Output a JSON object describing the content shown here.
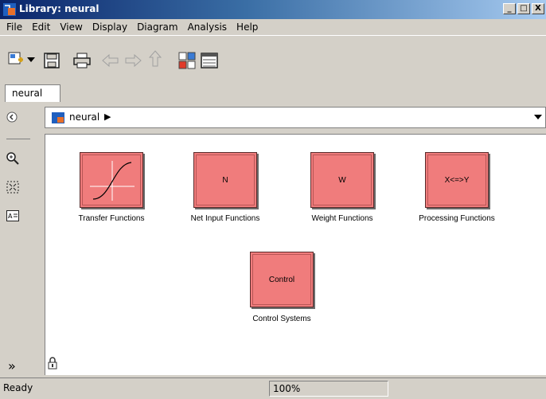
{
  "window": {
    "title": "Library: neural"
  },
  "title_buttons": {
    "minimize": "_",
    "maximize": "□",
    "close": "X"
  },
  "menu": [
    "File",
    "Edit",
    "View",
    "Display",
    "Diagram",
    "Analysis",
    "Help"
  ],
  "tab": {
    "label": "neural"
  },
  "address": {
    "path": "neural",
    "arrow": "▶"
  },
  "blocks": [
    {
      "text": "",
      "label": "Transfer Functions",
      "icon": "sigmoid-curve"
    },
    {
      "text": "N",
      "label": "Net Input Functions"
    },
    {
      "text": "W",
      "label": "Weight Functions"
    },
    {
      "text": "X<=>Y",
      "label": "Processing Functions"
    },
    {
      "text": "Control",
      "label": "Control Systems"
    }
  ],
  "status": {
    "left": "Ready",
    "zoom": "100%"
  },
  "palette": {
    "expand": "»"
  },
  "colors": {
    "block_fill": "#f07c7c",
    "titlebar_start": "#0a246a"
  }
}
